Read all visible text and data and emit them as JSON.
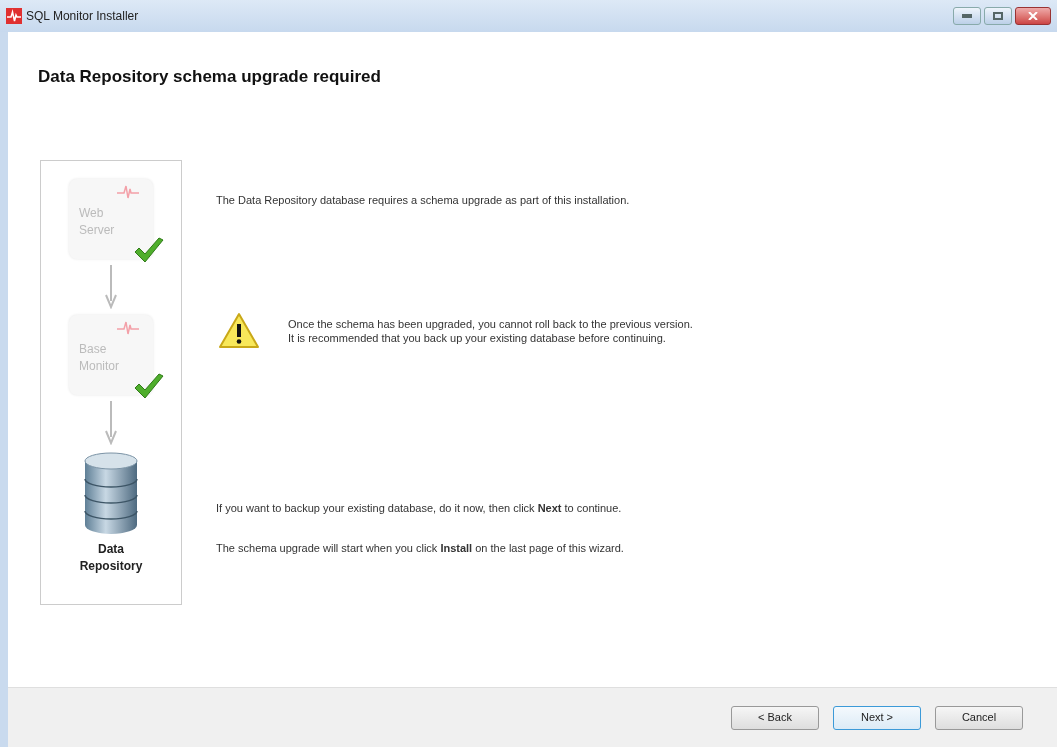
{
  "window": {
    "title": "SQL Monitor Installer"
  },
  "heading": "Data Repository schema upgrade required",
  "steps": [
    {
      "label": "Web Server",
      "completed": true
    },
    {
      "label": "Base Monitor",
      "completed": true
    },
    {
      "label": "Data Repository",
      "completed": false
    }
  ],
  "intro": "The Data Repository database requires a schema upgrade as part of this installation.",
  "warning": [
    "Once the schema has been upgraded, you cannot roll back to the previous version.",
    "It is recommended that you back up your existing database before continuing."
  ],
  "notes": [
    "If you want to backup your existing database, do it now, then click **Next** to continue.",
    "The schema upgrade will start when you click **Install** on the last page of this wizard."
  ],
  "buttons": [
    {
      "label": "< Back",
      "default": false
    },
    {
      "label": "Next >",
      "default": true
    },
    {
      "label": "Cancel",
      "default": false
    }
  ]
}
